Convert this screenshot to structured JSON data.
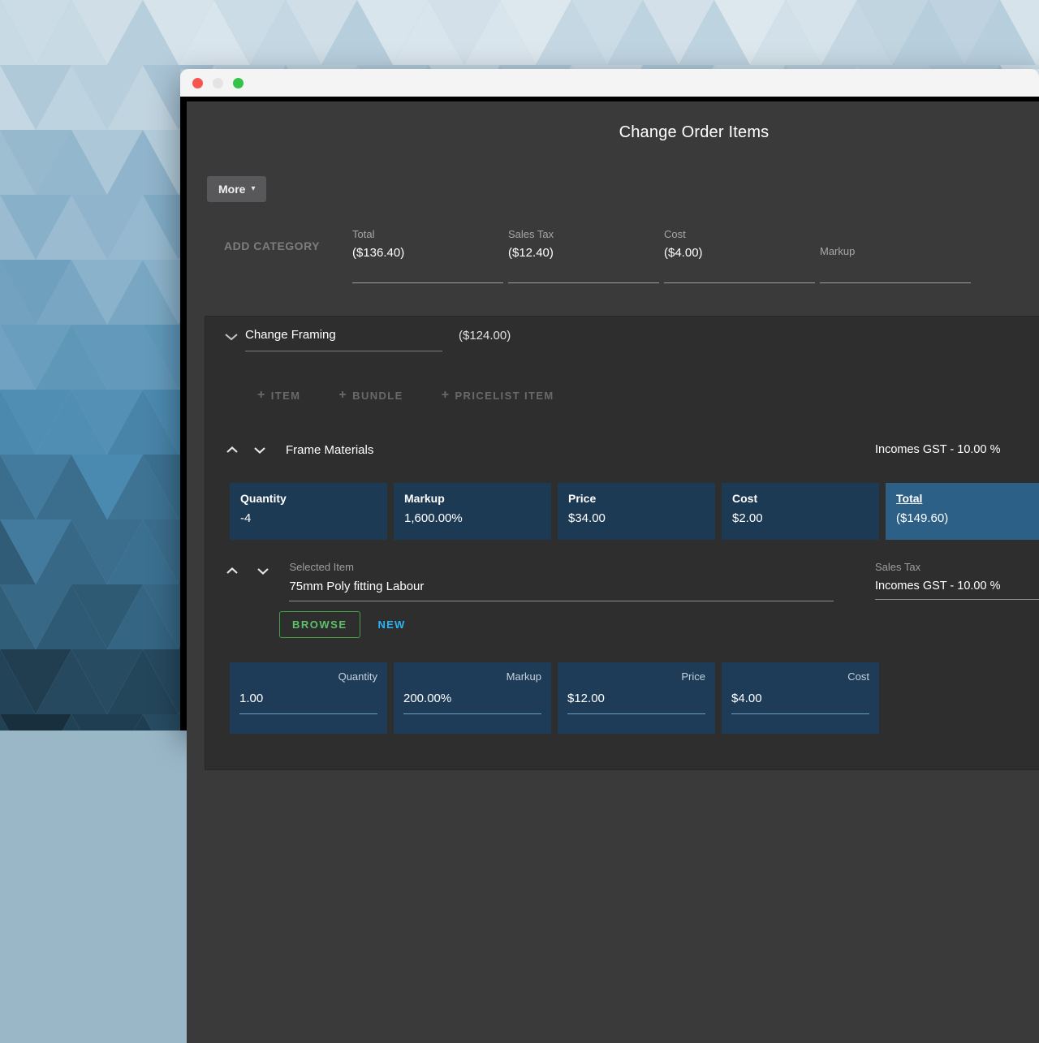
{
  "dialog": {
    "title": "Change Order Items",
    "more_label": "More",
    "add_category_label": "ADD CATEGORY",
    "summary_fields": [
      {
        "label": "Total",
        "value": "($136.40)"
      },
      {
        "label": "Sales Tax",
        "value": "($12.40)"
      },
      {
        "label": "Cost",
        "value": "($4.00)"
      },
      {
        "label": "Markup",
        "value": ""
      }
    ]
  },
  "category": {
    "name": "Change Framing",
    "total": "($124.00)",
    "actions": [
      {
        "label": "ITEM"
      },
      {
        "label": "BUNDLE"
      },
      {
        "label": "PRICELIST ITEM"
      }
    ],
    "group": {
      "name": "Frame Materials",
      "tax": "Incomes GST - 10.00 %",
      "stats": [
        {
          "label": "Quantity",
          "value": "-4"
        },
        {
          "label": "Markup",
          "value": "1,600.00%"
        },
        {
          "label": "Price",
          "value": "$34.00"
        },
        {
          "label": "Cost",
          "value": "$2.00"
        },
        {
          "label": "Total",
          "value": "($149.60)"
        }
      ]
    },
    "item": {
      "selected_label": "Selected Item",
      "selected_value": "75mm Poly fitting Labour",
      "sales_tax_label": "Sales Tax",
      "sales_tax_value": "Incomes GST - 10.00 %",
      "browse_label": "BROWSE",
      "new_label": "NEW",
      "fields": [
        {
          "label": "Quantity",
          "value": "1.00"
        },
        {
          "label": "Markup",
          "value": "200.00%"
        },
        {
          "label": "Price",
          "value": "$12.00"
        },
        {
          "label": "Cost",
          "value": "$4.00"
        }
      ]
    }
  },
  "colors": {
    "stat_cell_bg": "#1d3a55",
    "stat_cell_highlight_bg": "#2d6086",
    "browse_green": "#4caf50",
    "new_blue": "#29b6f6"
  }
}
